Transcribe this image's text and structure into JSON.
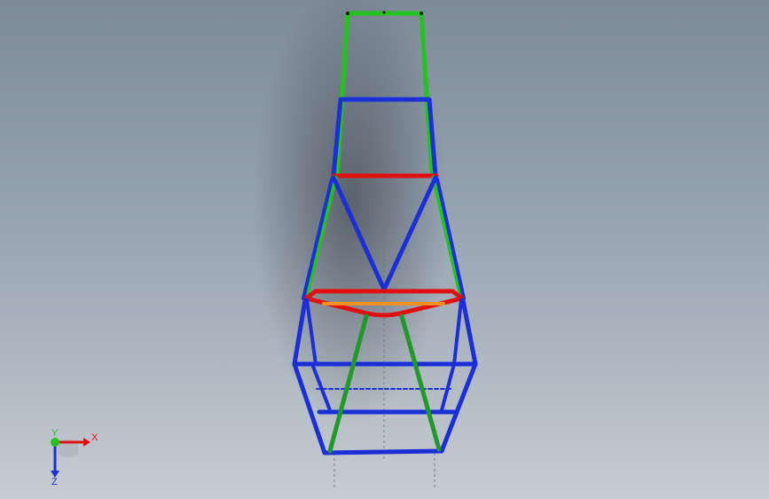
{
  "viewport": {
    "background_top": "#7d8a98",
    "background_bottom": "#c7ccd2"
  },
  "model": {
    "member_colors": {
      "blue": "#1a2fd6",
      "green": "#22c41c",
      "dark_green": "#1f9a2a",
      "red": "#e01010",
      "orange": "#f09020"
    }
  },
  "triad": {
    "x_label": "X",
    "y_label": "Y",
    "z_label": "Z",
    "x_color": "#e01010",
    "y_color": "#22c41c",
    "z_color": "#1a2fd6"
  }
}
